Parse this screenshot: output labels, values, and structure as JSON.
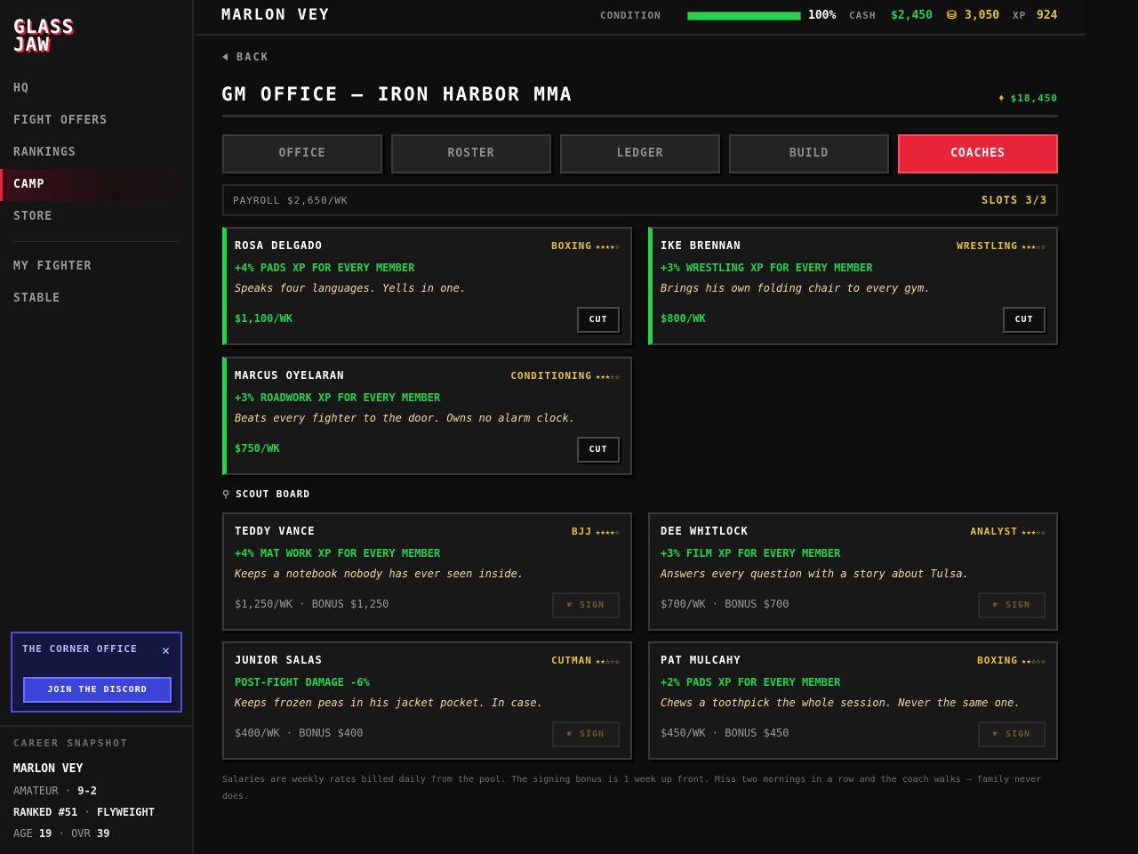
{
  "app": {
    "logo_line1": "GLASS",
    "logo_line2": "JAW"
  },
  "sidebar": {
    "nav": [
      {
        "label": "HQ"
      },
      {
        "label": "FIGHT OFFERS"
      },
      {
        "label": "RANKINGS"
      },
      {
        "label": "CAMP",
        "active": true
      },
      {
        "label": "STORE"
      }
    ],
    "nav2": [
      {
        "label": "MY FIGHTER"
      },
      {
        "label": "STABLE"
      }
    ],
    "promo": {
      "title": "THE CORNER OFFICE",
      "close": "✕",
      "button": "JOIN THE DISCORD"
    },
    "snapshot": {
      "title": "CAREER SNAPSHOT",
      "name": "MARLON VEY",
      "level": "AMATEUR",
      "record": "9-2",
      "rank": "RANKED #51",
      "division": "FLYWEIGHT",
      "age_label": "AGE",
      "age": "19",
      "ovr_label": "OVR",
      "ovr": "39"
    }
  },
  "topbar": {
    "name": "MARLON VEY",
    "condition_label": "CONDITION",
    "condition_pct": "100%",
    "condition_value": 1.0,
    "cash_label": "CASH",
    "cash": "$2,450",
    "coins": "3,050",
    "xp_label": "XP",
    "xp": "924"
  },
  "page": {
    "back": "BACK",
    "title": "GM OFFICE — IRON HARBOR MMA",
    "bank": "$18,450",
    "tabs": [
      {
        "label": "OFFICE"
      },
      {
        "label": "ROSTER"
      },
      {
        "label": "LEDGER"
      },
      {
        "label": "BUILD"
      },
      {
        "label": "COACHES",
        "active": true
      }
    ],
    "payroll": "PAYROLL $2,650/WK",
    "slots": "SLOTS 3/3"
  },
  "hired": [
    {
      "name": "ROSA DELGADO",
      "spec": "BOXING",
      "stars": 4,
      "perk": "+4% PADS XP FOR EVERY MEMBER",
      "quote": "Speaks four languages. Yells in one.",
      "price": "$1,100/WK",
      "action": "CUT"
    },
    {
      "name": "IKE BRENNAN",
      "spec": "WRESTLING",
      "stars": 3,
      "perk": "+3% WRESTLING XP FOR EVERY MEMBER",
      "quote": "Brings his own folding chair to every gym.",
      "price": "$800/WK",
      "action": "CUT"
    },
    {
      "name": "MARCUS OYELARAN",
      "spec": "CONDITIONING",
      "stars": 3,
      "perk": "+3% ROADWORK XP FOR EVERY MEMBER",
      "quote": "Beats every fighter to the door. Owns no alarm clock.",
      "price": "$750/WK",
      "action": "CUT"
    }
  ],
  "scout": {
    "title": "SCOUT BOARD",
    "items": [
      {
        "name": "TEDDY VANCE",
        "spec": "BJJ",
        "stars": 4,
        "perk": "+4% MAT WORK XP FOR EVERY MEMBER",
        "quote": "Keeps a notebook nobody has ever seen inside.",
        "price": "$1,250/WK · BONUS $1,250",
        "action": "SIGN"
      },
      {
        "name": "DEE WHITLOCK",
        "spec": "ANALYST",
        "stars": 3,
        "perk": "+3% FILM XP FOR EVERY MEMBER",
        "quote": "Answers every question with a story about Tulsa.",
        "price": "$700/WK · BONUS $700",
        "action": "SIGN"
      },
      {
        "name": "JUNIOR SALAS",
        "spec": "CUTMAN",
        "stars": 2,
        "perk": "POST-FIGHT DAMAGE -6%",
        "quote": "Keeps frozen peas in his jacket pocket. In case.",
        "price": "$400/WK · BONUS $400",
        "action": "SIGN"
      },
      {
        "name": "PAT MULCAHY",
        "spec": "BOXING",
        "stars": 2,
        "perk": "+2% PADS XP FOR EVERY MEMBER",
        "quote": "Chews a toothpick the whole session. Never the same one.",
        "price": "$450/WK · BONUS $450",
        "action": "SIGN"
      }
    ]
  },
  "footnote": "Salaries are weekly rates billed daily from the pool. The signing bonus is 1 week up front. Miss two mornings in a row and the coach walks — family never does.",
  "colors": {
    "accent": "#e8243a",
    "money": "#27d24c",
    "gold": "#e8c23a",
    "discord": "#3b43d9"
  },
  "icons": {
    "back": "triangle-left-icon",
    "bank": "money-bag-icon",
    "coins": "coin-stack-icon",
    "scout": "magnifier-icon",
    "sign": "hand-icon",
    "close": "close-icon"
  }
}
